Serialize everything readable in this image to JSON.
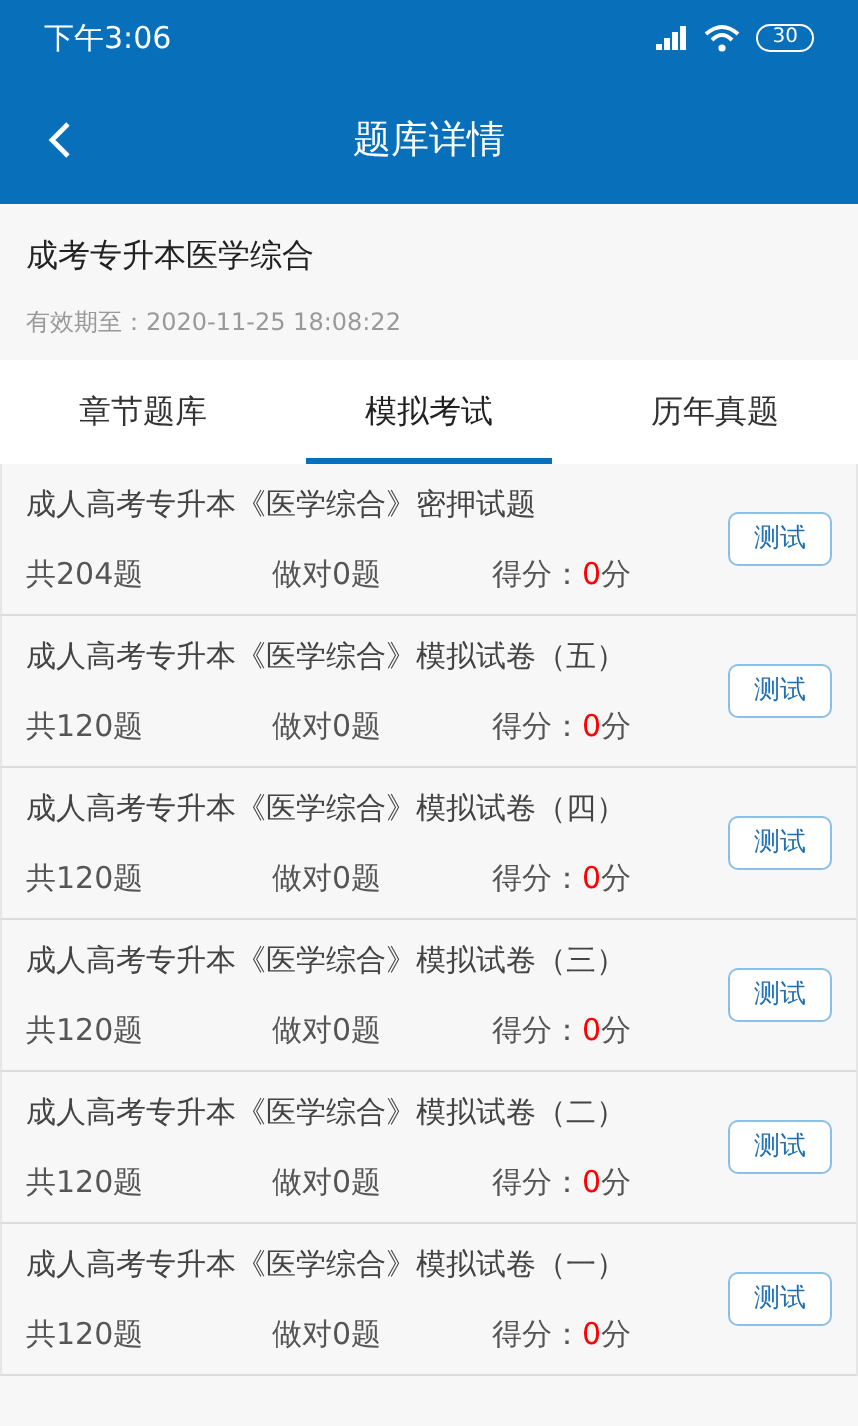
{
  "status_bar": {
    "time": "下午3:06",
    "battery": "30"
  },
  "header": {
    "title": "题库详情"
  },
  "bank": {
    "name": "成考专升本医学综合",
    "expiry": "有效期至：2020-11-25 18:08:22"
  },
  "tabs": [
    {
      "label": "章节题库",
      "selected": false
    },
    {
      "label": "模拟考试",
      "selected": true
    },
    {
      "label": "历年真题",
      "selected": false
    }
  ],
  "exams": [
    {
      "title": "成人高考专升本《医学综合》密押试题",
      "total": "共204题",
      "correct": "做对0题",
      "score_label": "得分：",
      "score": "0",
      "score_unit": "分",
      "button": "测试"
    },
    {
      "title": "成人高考专升本《医学综合》模拟试卷（五）",
      "total": "共120题",
      "correct": "做对0题",
      "score_label": "得分：",
      "score": "0",
      "score_unit": "分",
      "button": "测试"
    },
    {
      "title": "成人高考专升本《医学综合》模拟试卷（四）",
      "total": "共120题",
      "correct": "做对0题",
      "score_label": "得分：",
      "score": "0",
      "score_unit": "分",
      "button": "测试"
    },
    {
      "title": "成人高考专升本《医学综合》模拟试卷（三）",
      "total": "共120题",
      "correct": "做对0题",
      "score_label": "得分：",
      "score": "0",
      "score_unit": "分",
      "button": "测试"
    },
    {
      "title": "成人高考专升本《医学综合》模拟试卷（二）",
      "total": "共120题",
      "correct": "做对0题",
      "score_label": "得分：",
      "score": "0",
      "score_unit": "分",
      "button": "测试"
    },
    {
      "title": "成人高考专升本《医学综合》模拟试卷（一）",
      "total": "共120题",
      "correct": "做对0题",
      "score_label": "得分：",
      "score": "0",
      "score_unit": "分",
      "button": "测试"
    }
  ]
}
